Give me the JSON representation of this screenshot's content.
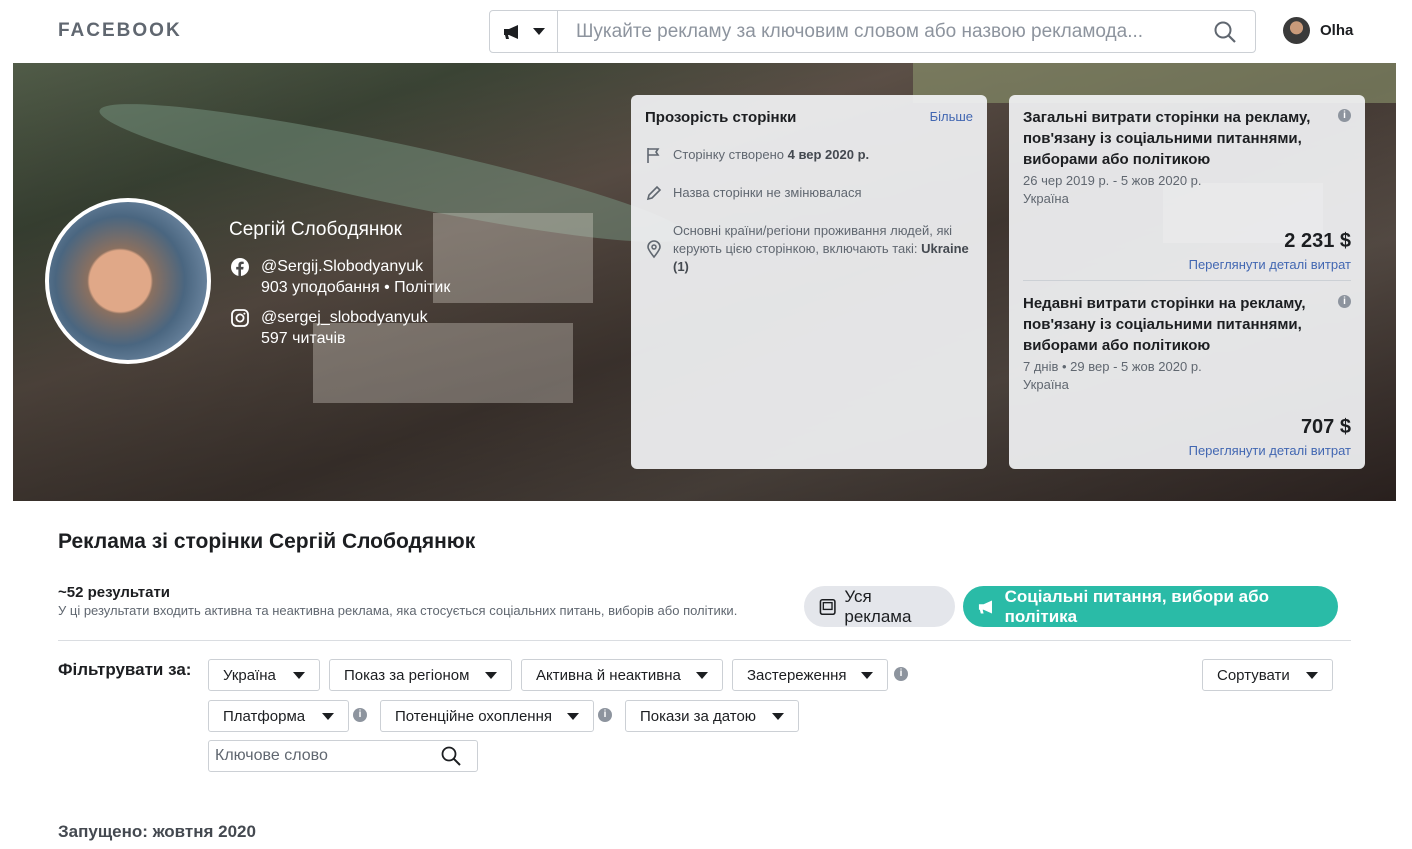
{
  "header": {
    "logo": "FACEBOOK",
    "search_placeholder": "Шукайте рекламу за ключовим словом або назвою рекламода...",
    "user_name": "Olha"
  },
  "page": {
    "name": "Сергій Слободянюк",
    "facebook_handle": "@Sergij.Slobodyanyuk",
    "facebook_stats": "903 уподобання • Політик",
    "instagram_handle": "@sergej_slobodyanyuk",
    "instagram_stats": "597 читачів"
  },
  "transparency": {
    "title": "Прозорість сторінки",
    "more": "Більше",
    "created_prefix": "Сторінку створено ",
    "created_date": "4 вер 2020 р.",
    "name_unchanged": "Назва сторінки не змінювалася",
    "countries_text": "Основні країни/регіони проживання людей, які керують цією сторінкою, включають такі: ",
    "countries_value": "Ukraine (1)"
  },
  "spend_total": {
    "title": "Загальні витрати сторінки на рекламу, пов'язану із соціальними питаннями, виборами або політикою",
    "period": "26 чер 2019 р. - 5 жов 2020 р.",
    "region": "Україна",
    "amount": "2 231 $",
    "link": "Переглянути деталі витрат"
  },
  "spend_recent": {
    "title": "Недавні витрати сторінки на рекламу, пов'язану із соціальними питаннями, виборами або політикою",
    "period": "7 днів • 29 вер - 5 жов 2020 р.",
    "region": "Україна",
    "amount": "707 $",
    "link": "Переглянути деталі витрат"
  },
  "results": {
    "heading": "Реклама зі сторінки Сергій Слободянюк",
    "count": "~52 результати",
    "subtitle": "У ці результати входить активна та неактивна реклама, яка стосується соціальних питань, виборів або політики.",
    "tab_all": "Уся реклама",
    "tab_social": "Соціальні питання, вибори або політика"
  },
  "filters": {
    "label": "Фільтрувати за:",
    "country": "Україна",
    "region": "Показ за регіоном",
    "status": "Активна й неактивна",
    "disclaimer": "Застереження",
    "sort": "Сортувати",
    "platform": "Платформа",
    "reach": "Потенційне охоплення",
    "date": "Покази за датою",
    "keyword_placeholder": "Ключове слово"
  },
  "section": {
    "launched": "Запущено: жовтня 2020"
  },
  "colors": {
    "accent_teal": "#2abba7",
    "link_blue": "#4267b2"
  }
}
